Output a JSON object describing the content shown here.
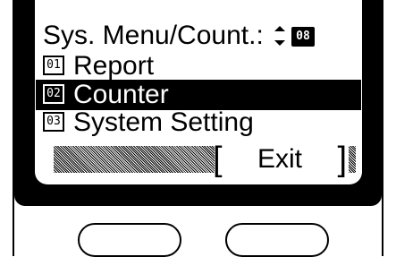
{
  "screen": {
    "title": "Sys. Menu/Count.:",
    "page_indicator": "08",
    "items": [
      {
        "number": "01",
        "label": "Report",
        "selected": false
      },
      {
        "number": "02",
        "label": "Counter",
        "selected": true
      },
      {
        "number": "03",
        "label": "System Setting",
        "selected": false
      }
    ],
    "softkey": {
      "label": "Exit",
      "bracket_left": "[",
      "bracket_right": "]"
    }
  },
  "icons": {
    "scroll": "up-down-arrows-icon",
    "number": "item-number-icon"
  },
  "colors": {
    "display_bg": "#ffffff",
    "bezel": "#000000",
    "highlight": "#000000"
  }
}
